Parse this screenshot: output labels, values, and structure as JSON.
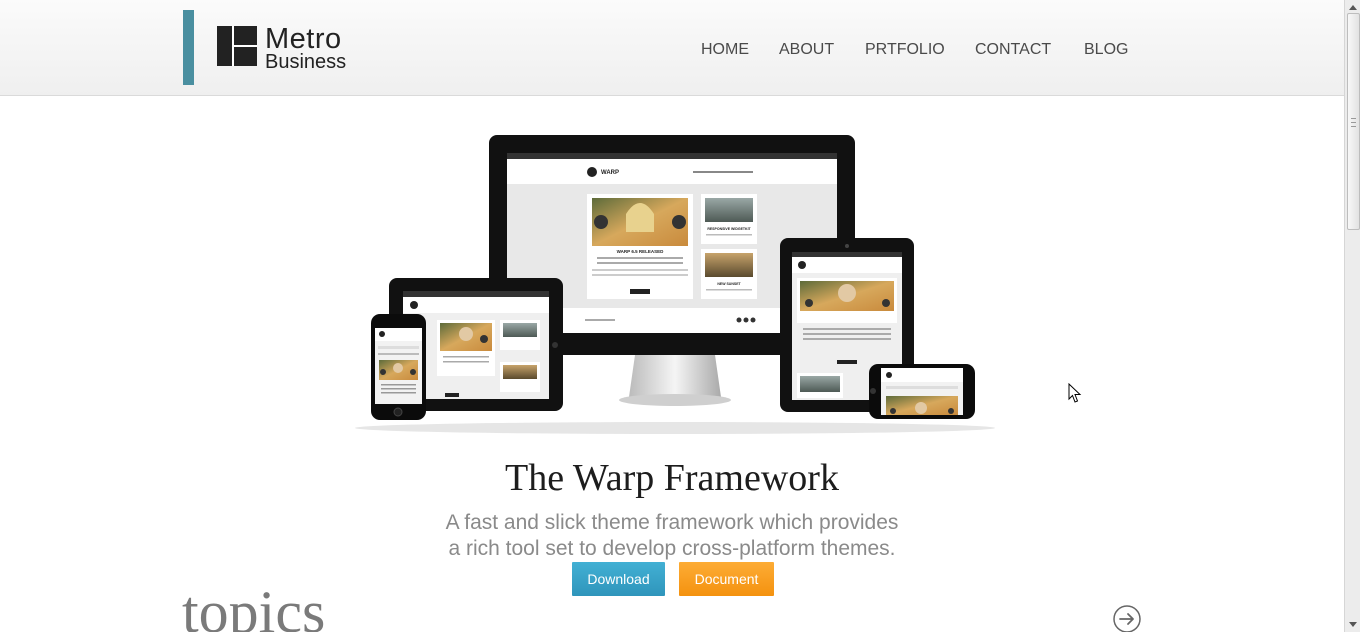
{
  "logo": {
    "line1": "Metro",
    "line2": "Business",
    "accent_color": "#4a8fa0"
  },
  "nav": {
    "items": [
      {
        "label": "HOME"
      },
      {
        "label": "ABOUT"
      },
      {
        "label": "PRTFOLIO"
      },
      {
        "label": "CONTACT"
      },
      {
        "label": "BLOG"
      }
    ]
  },
  "hero": {
    "image_label": "responsive-devices-illustration",
    "title": "The Warp Framework",
    "subtitle_line1": "A fast and slick theme framework which provides",
    "subtitle_line2": "a rich tool set to develop cross-platform themes.",
    "download_label": "Download",
    "document_label": "Document",
    "download_color": "#2f95bb",
    "document_color": "#f4920f"
  },
  "devices": {
    "brand": "WARP",
    "headline": "WARP 6.5 RELEASED",
    "side_title1": "RESPONSIVE WIDGETKIT",
    "side_title2": "NEW SUNSET"
  },
  "topics": {
    "heading": "topics",
    "arrow_icon": "circle-arrow-right-icon"
  }
}
